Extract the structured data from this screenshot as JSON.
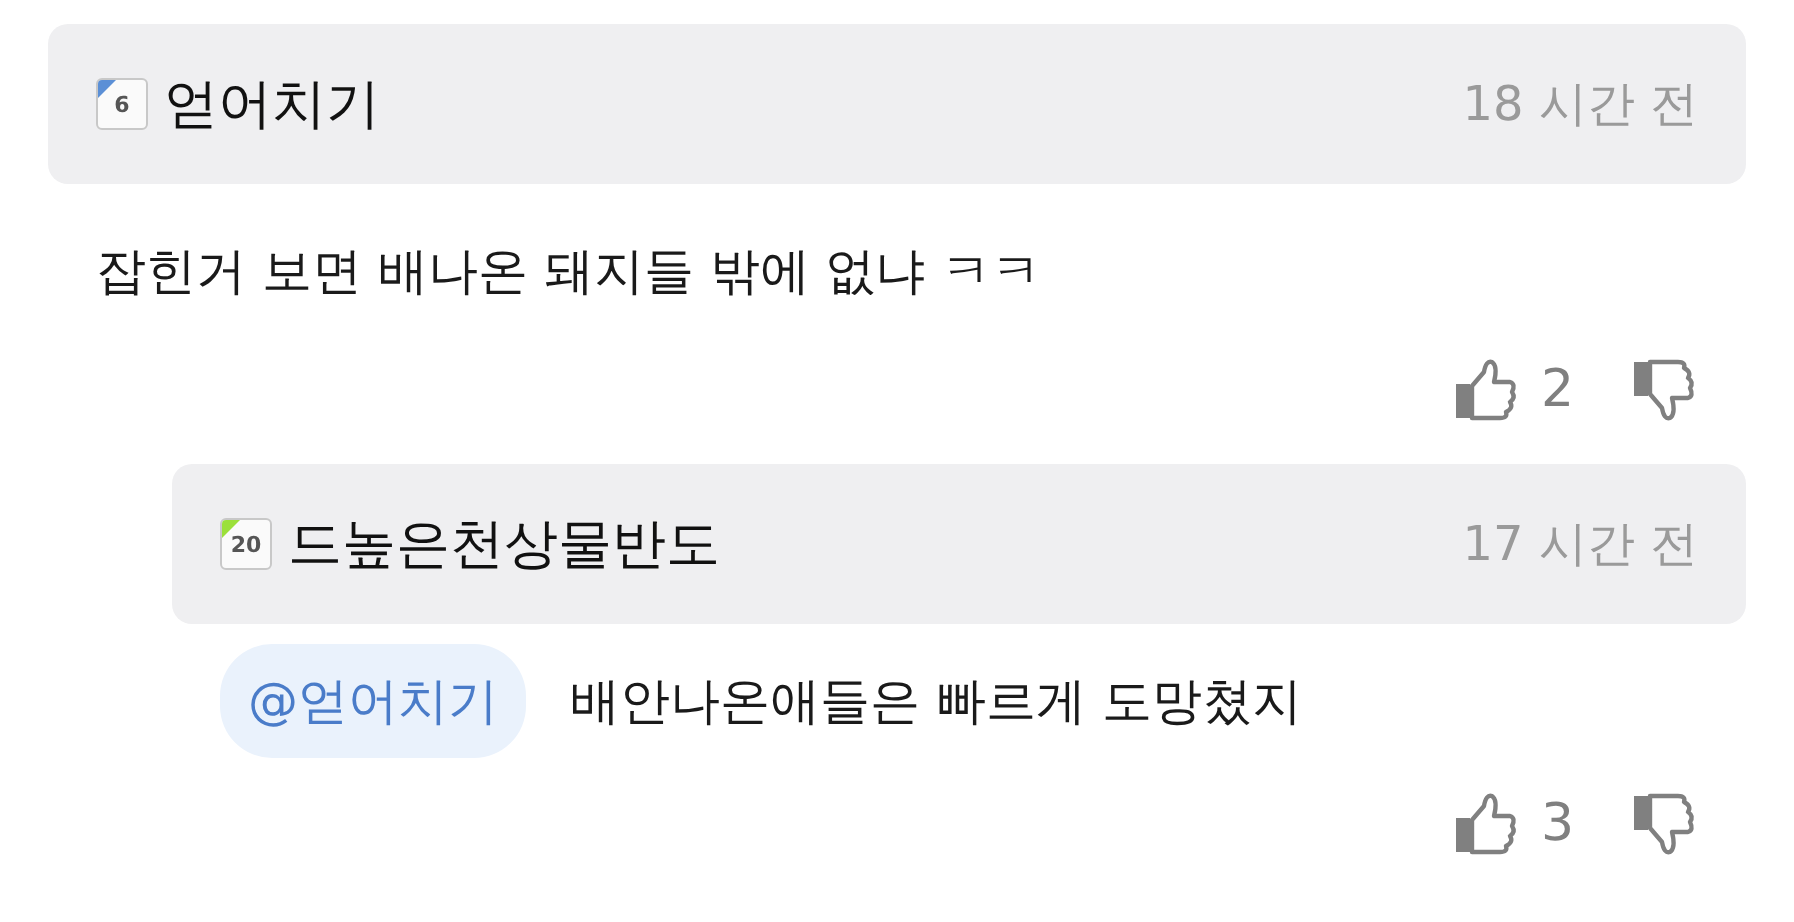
{
  "comments": [
    {
      "level": "6",
      "color": "#5b8fd6",
      "author": "얻어치기",
      "time": "18 시간 전",
      "text": "잡힌거 보면 배나온 돼지들 밖에 없냐 ㅋㅋ",
      "likes": "2",
      "children": [
        {
          "level": "20",
          "color": "#9be03a",
          "author": "드높은천상물반도",
          "time": "17 시간 전",
          "mention": "@얻어치기",
          "text": "배안나온애들은 빠르게 도망쳤지",
          "likes": "3"
        }
      ]
    }
  ]
}
